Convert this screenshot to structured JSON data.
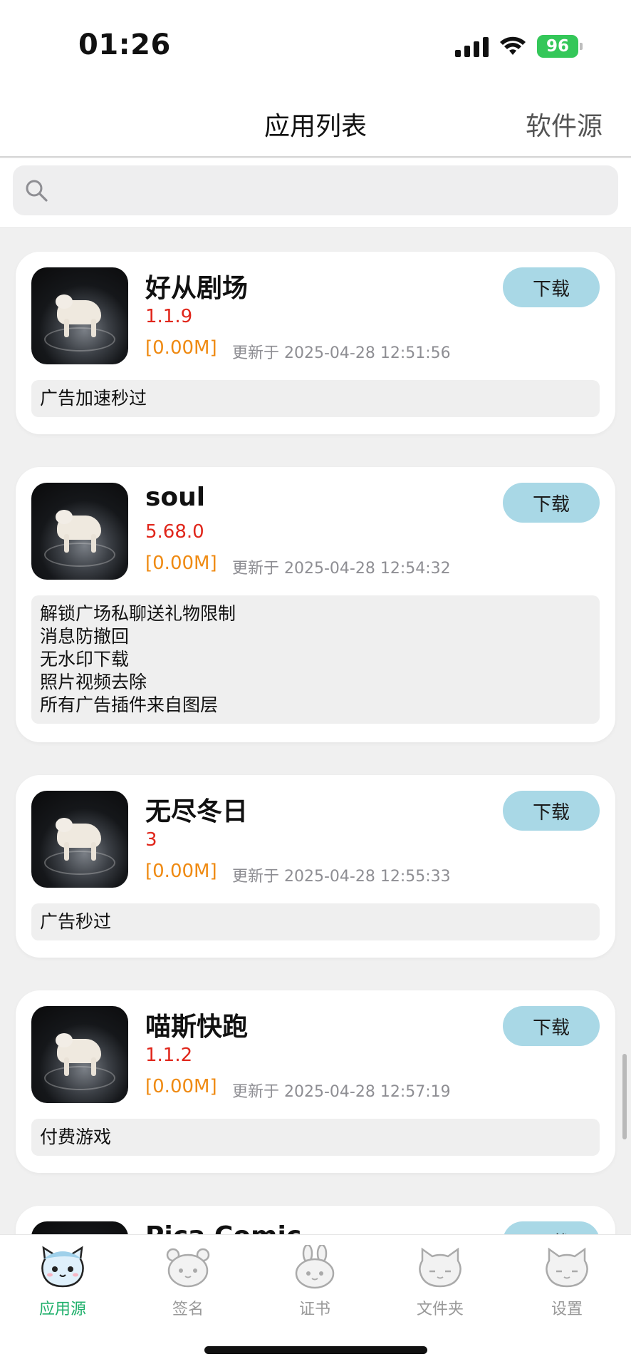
{
  "status_bar": {
    "time": "01:26",
    "battery": "96"
  },
  "nav": {
    "title": "应用列表",
    "right_action": "软件源"
  },
  "search": {
    "placeholder": ""
  },
  "apps": [
    {
      "name": "好从剧场",
      "version": "1.1.9",
      "size": "[0.00M]",
      "updated": "更新于 2025-04-28 12:51:56",
      "button": "下载",
      "description": "广告加速秒过"
    },
    {
      "name": "soul",
      "version": "5.68.0",
      "size": "[0.00M]",
      "updated": "更新于 2025-04-28 12:54:32",
      "button": "下载",
      "description": "解锁广场私聊送礼物限制\n消息防撤回\n无水印下载\n照片视频去除\n所有广告插件来自图层"
    },
    {
      "name": "无尽冬日",
      "version": "3",
      "size": "[0.00M]",
      "updated": "更新于 2025-04-28 12:55:33",
      "button": "下载",
      "description": "广告秒过"
    },
    {
      "name": "喵斯快跑",
      "version": "1.1.2",
      "size": "[0.00M]",
      "updated": "更新于 2025-04-28 12:57:19",
      "button": "下载",
      "description": "付费游戏"
    },
    {
      "name": "Pica Comic",
      "version": "",
      "size": "",
      "updated": "",
      "button": "下载",
      "description": ""
    }
  ],
  "tabbar": {
    "items": [
      {
        "label": "应用源",
        "icon": "cat-face-icon",
        "active": true
      },
      {
        "label": "签名",
        "icon": "bear-face-icon",
        "active": false
      },
      {
        "label": "证书",
        "icon": "rabbit-face-icon",
        "active": false
      },
      {
        "label": "文件夹",
        "icon": "cat-face-icon",
        "active": false
      },
      {
        "label": "设置",
        "icon": "cat-face-icon",
        "active": false
      }
    ]
  },
  "colors": {
    "accent": "#1fb06b",
    "version": "#e0261b",
    "size": "#ef8a12",
    "button_bg": "#a9d8e6",
    "battery": "#34c759"
  }
}
